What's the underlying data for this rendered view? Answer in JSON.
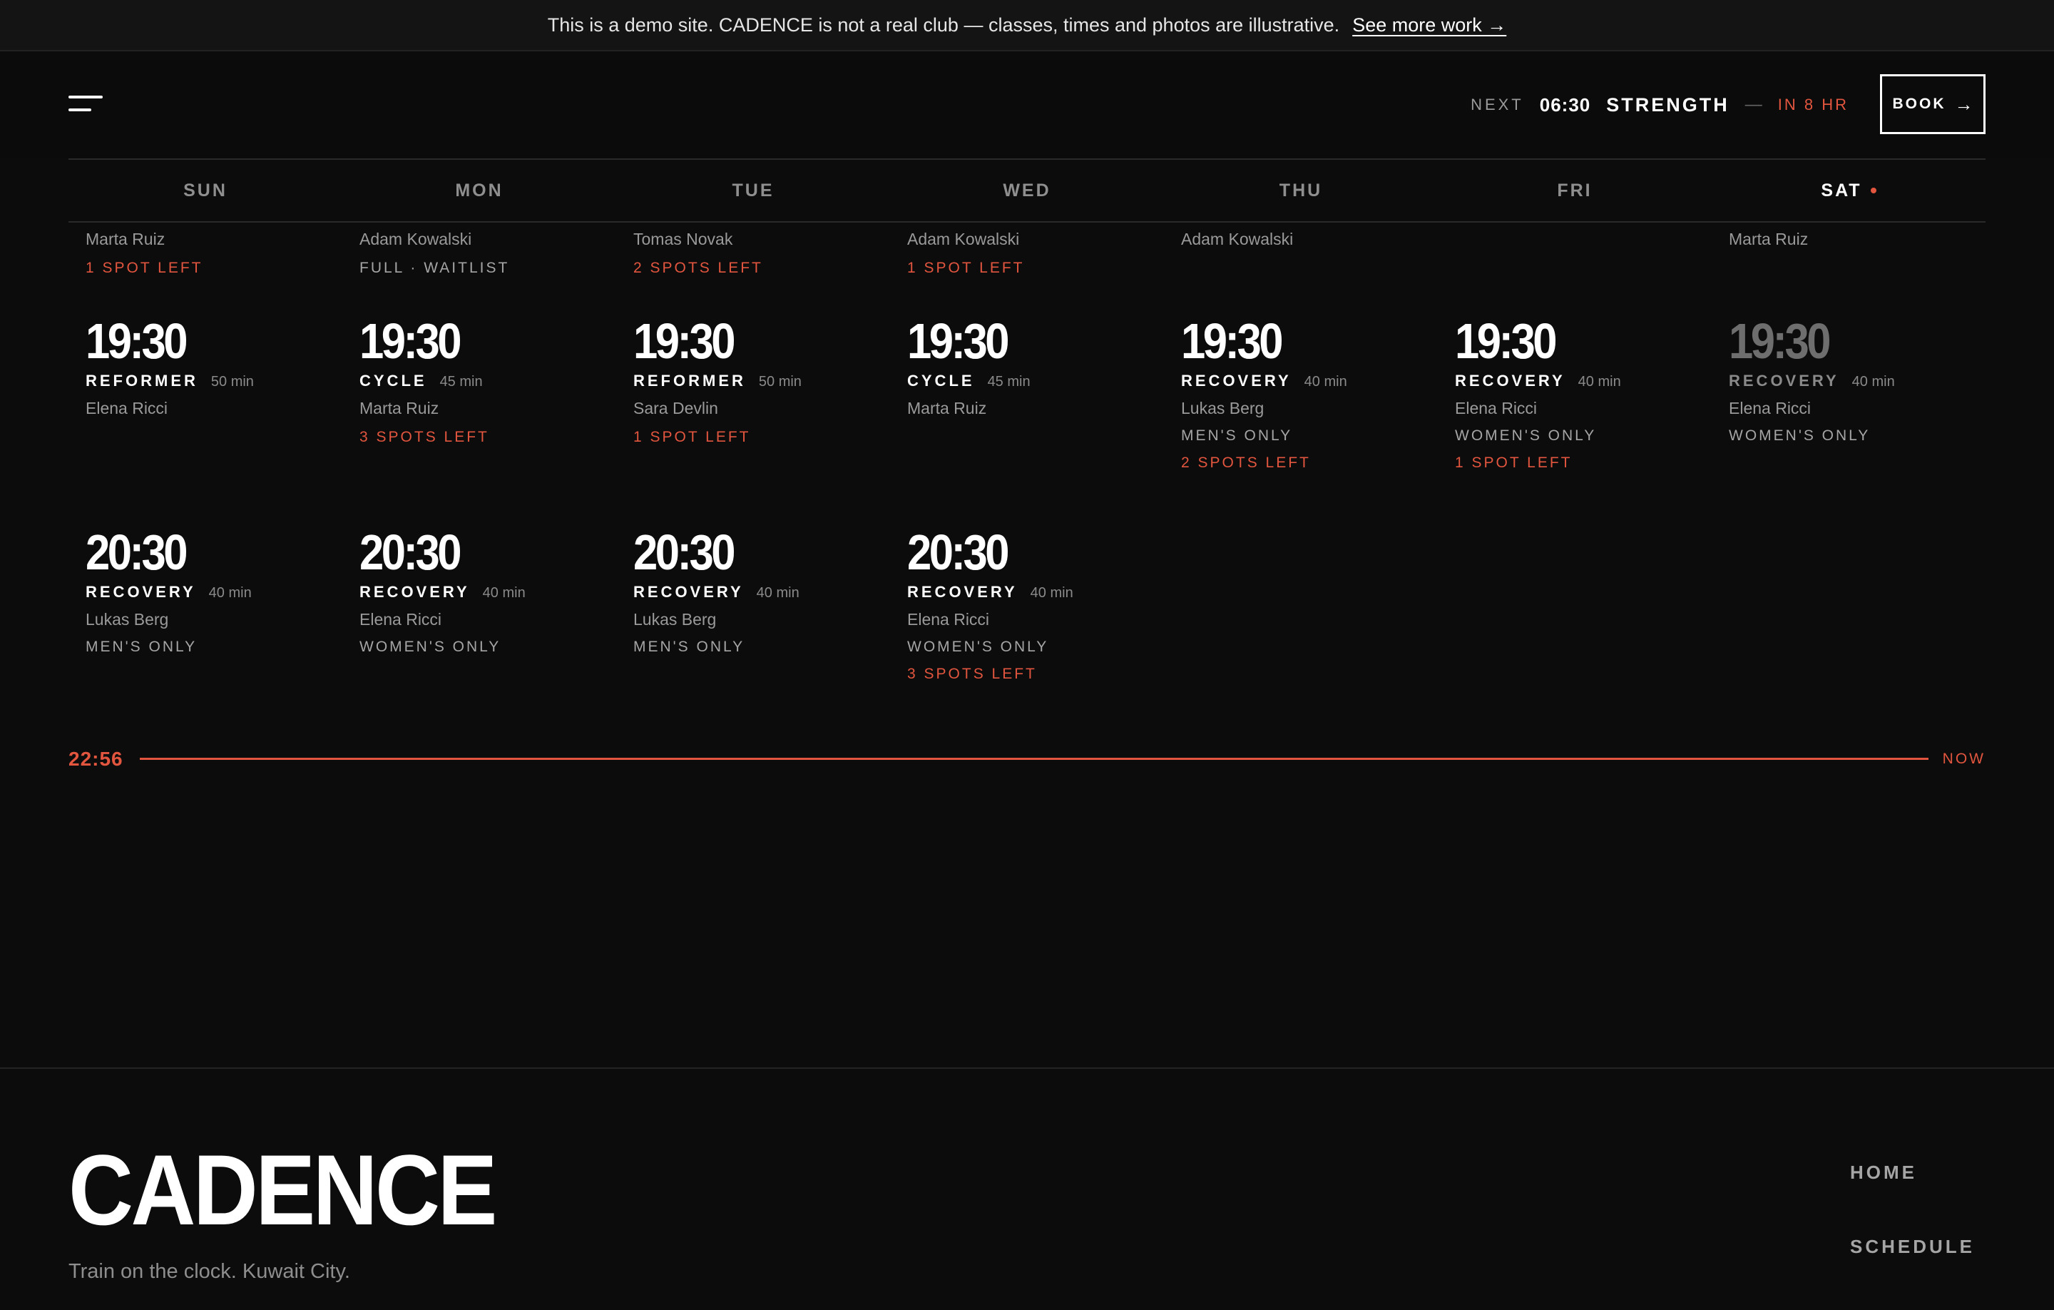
{
  "banner": {
    "text": "This is a demo site. CADENCE is not a real club — classes, times and photos are illustrative.",
    "link": "See more work →"
  },
  "header": {
    "menu_icon": "hamburger-menu-icon",
    "next_label": "NEXT",
    "next_time": "06:30",
    "next_class": "STRENGTH",
    "dash": "—",
    "next_eta": "IN 8 HR",
    "book_label": "BOOK",
    "book_arrow": "→"
  },
  "days": [
    {
      "label": "SUN",
      "active": false
    },
    {
      "label": "MON",
      "active": false
    },
    {
      "label": "TUE",
      "active": false
    },
    {
      "label": "WED",
      "active": false
    },
    {
      "label": "THU",
      "active": false
    },
    {
      "label": "FRI",
      "active": false
    },
    {
      "label": "SAT",
      "active": true
    }
  ],
  "schedule": [
    {
      "carry": {
        "instructor": "Marta Ruiz",
        "note": "1 SPOT LEFT",
        "note_type": "spots"
      },
      "classes": [
        {
          "time": "19:30",
          "name": "REFORMER",
          "duration": "50 min",
          "instructor": "Elena Ricci",
          "gender": "",
          "spots": ""
        },
        {
          "time": "20:30",
          "name": "RECOVERY",
          "duration": "40 min",
          "instructor": "Lukas Berg",
          "gender": "MEN'S ONLY",
          "spots": ""
        }
      ]
    },
    {
      "carry": {
        "instructor": "Adam Kowalski",
        "note": "FULL · WAITLIST",
        "note_type": "status"
      },
      "classes": [
        {
          "time": "19:30",
          "name": "CYCLE",
          "duration": "45 min",
          "instructor": "Marta Ruiz",
          "gender": "",
          "spots": "3 SPOTS LEFT"
        },
        {
          "time": "20:30",
          "name": "RECOVERY",
          "duration": "40 min",
          "instructor": "Elena Ricci",
          "gender": "WOMEN'S ONLY",
          "spots": ""
        }
      ]
    },
    {
      "carry": {
        "instructor": "Tomas Novak",
        "note": "2 SPOTS LEFT",
        "note_type": "spots"
      },
      "classes": [
        {
          "time": "19:30",
          "name": "REFORMER",
          "duration": "50 min",
          "instructor": "Sara Devlin",
          "gender": "",
          "spots": "1 SPOT LEFT"
        },
        {
          "time": "20:30",
          "name": "RECOVERY",
          "duration": "40 min",
          "instructor": "Lukas Berg",
          "gender": "MEN'S ONLY",
          "spots": ""
        }
      ]
    },
    {
      "carry": {
        "instructor": "Adam Kowalski",
        "note": "1 SPOT LEFT",
        "note_type": "spots"
      },
      "classes": [
        {
          "time": "19:30",
          "name": "CYCLE",
          "duration": "45 min",
          "instructor": "Marta Ruiz",
          "gender": "",
          "spots": ""
        },
        {
          "time": "20:30",
          "name": "RECOVERY",
          "duration": "40 min",
          "instructor": "Elena Ricci",
          "gender": "WOMEN'S ONLY",
          "spots": "3 SPOTS LEFT"
        }
      ]
    },
    {
      "carry": {
        "instructor": "Adam Kowalski",
        "note": "",
        "note_type": ""
      },
      "classes": [
        {
          "time": "19:30",
          "name": "RECOVERY",
          "duration": "40 min",
          "instructor": "Lukas Berg",
          "gender": "MEN'S ONLY",
          "spots": "2 SPOTS LEFT"
        }
      ]
    },
    {
      "carry": {
        "instructor": "",
        "note": "",
        "note_type": ""
      },
      "classes": [
        {
          "time": "19:30",
          "name": "RECOVERY",
          "duration": "40 min",
          "instructor": "Elena Ricci",
          "gender": "WOMEN'S ONLY",
          "spots": "1 SPOT LEFT"
        }
      ]
    },
    {
      "carry": {
        "instructor": "Marta Ruiz",
        "note": "",
        "note_type": ""
      },
      "classes": [
        {
          "time": "19:30",
          "name": "RECOVERY",
          "duration": "40 min",
          "instructor": "Elena Ricci",
          "gender": "WOMEN'S ONLY",
          "spots": "",
          "past": true
        }
      ]
    }
  ],
  "now": {
    "time": "22:56",
    "label": "NOW"
  },
  "footer": {
    "brand": "CADENCE",
    "tagline": "Train on the clock. Kuwait City.",
    "nav": [
      "HOME",
      "SCHEDULE"
    ]
  },
  "colors": {
    "accent": "#e2553e",
    "background": "#0c0c0c",
    "muted": "#9a9a9a"
  }
}
